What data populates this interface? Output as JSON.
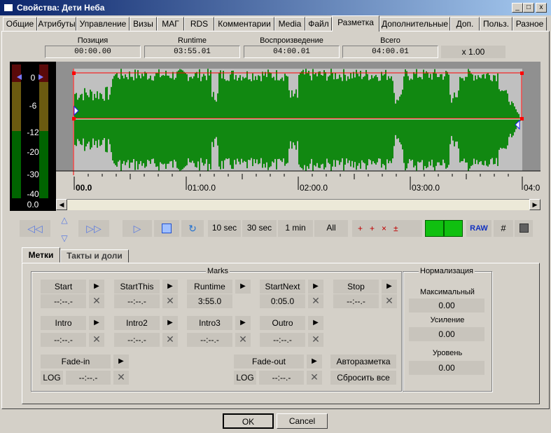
{
  "window": {
    "title": "Свойства: Дети Неба",
    "min": "_",
    "max": "□",
    "close": "x"
  },
  "tabs": [
    "Общие",
    "Атрибуты",
    "Управление",
    "Визы",
    "МАГ",
    "RDS",
    "Комментарии",
    "Media",
    "Файл",
    "Разметка",
    "Дополнительные",
    "Доп.",
    "Польз.",
    "Разное"
  ],
  "active_tab": "Разметка",
  "info": {
    "position_label": "Позиция",
    "position": "00:00.00",
    "runtime_label": "Runtime",
    "runtime": "03:55.01",
    "playback_label": "Воспроизведение",
    "playback": "04:00.01",
    "total_label": "Всего",
    "total": "04:00.01",
    "speed": "x 1.00"
  },
  "meter": {
    "ticks": [
      "0",
      "-6",
      "-12",
      "-20",
      "-30",
      "-40"
    ],
    "level": "0.0"
  },
  "timeline": {
    "ticks": [
      "00.0",
      "01:00.0",
      "02:00.0",
      "03:00.0",
      "04:0"
    ]
  },
  "transport": {
    "zoom10": "10 sec",
    "zoom30": "30 sec",
    "zoom1m": "1 min",
    "zoomall": "All",
    "raw": "RAW"
  },
  "subtabs": {
    "marks": "Метки",
    "beats": "Такты и доли"
  },
  "marks": {
    "group_title": "Marks",
    "start": {
      "label": "Start",
      "value": "--:--.-"
    },
    "startthis": {
      "label": "StartThis",
      "value": "--:--.-"
    },
    "runtime": {
      "label": "Runtime",
      "value": "3:55.0"
    },
    "startnext": {
      "label": "StartNext",
      "value": "0:05.0"
    },
    "stop": {
      "label": "Stop",
      "value": "--:--.-"
    },
    "intro": {
      "label": "Intro",
      "value": "--:--.-"
    },
    "intro2": {
      "label": "Intro2",
      "value": "--:--.-"
    },
    "intro3": {
      "label": "Intro3",
      "value": "--:--.-"
    },
    "outro": {
      "label": "Outro",
      "value": "--:--.-"
    },
    "fadein": {
      "label": "Fade-in",
      "mode": "LOG",
      "value": "--:--.-"
    },
    "fadeout": {
      "label": "Fade-out",
      "mode": "LOG",
      "value": "--:--.-"
    },
    "automark": "Авторазметка",
    "resetall": "Сбросить все"
  },
  "normalization": {
    "title": "Нормализация",
    "max_label": "Максимальный",
    "max": "0.00",
    "gain_label": "Усиление",
    "gain": "0.00",
    "level_label": "Уровень",
    "level": "0.00"
  },
  "footer": {
    "ok": "OK",
    "cancel": "Cancel"
  },
  "colors": {
    "waveform": "#118811",
    "marker": "#ff0000",
    "meter_green": "#006400",
    "meter_yellow": "#6b5a10",
    "meter_red": "#5a0a0a"
  }
}
